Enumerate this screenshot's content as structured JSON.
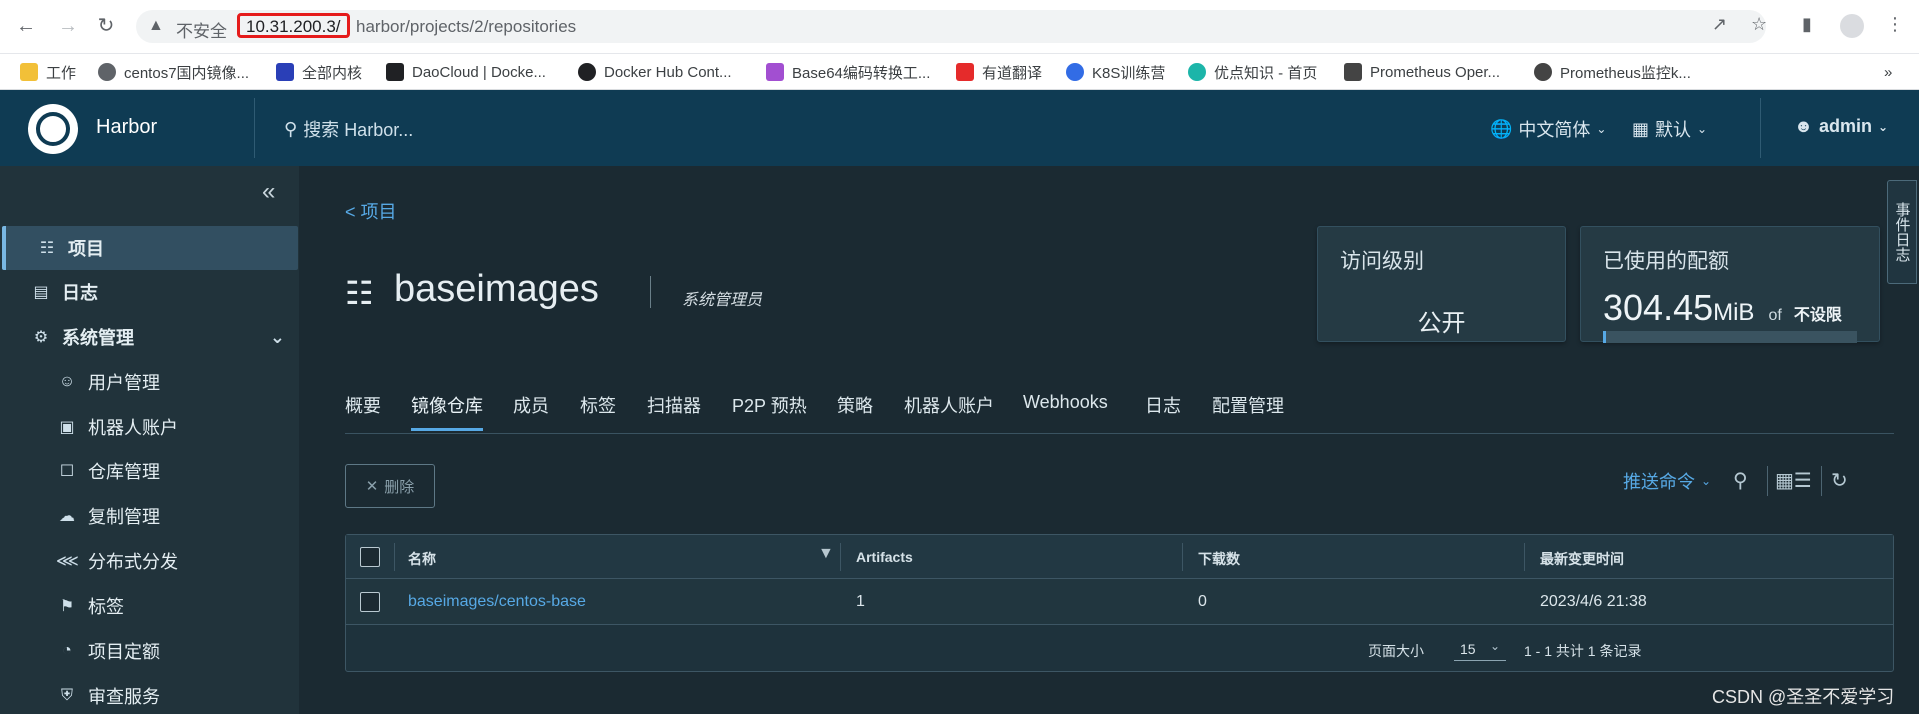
{
  "browser": {
    "insecure_label": "不安全",
    "url_host": "10.31.200.3/",
    "url_path": "harbor/projects/2/repositories",
    "bookmarks": [
      {
        "label": "工作",
        "color": "#f2c038"
      },
      {
        "label": "centos7国内镜像...",
        "color": "#5f6368"
      },
      {
        "label": "全部内核",
        "color": "#2a3fb7"
      },
      {
        "label": "DaoCloud | Docke...",
        "color": "#202124"
      },
      {
        "label": "Docker Hub Cont...",
        "color": "#202124"
      },
      {
        "label": "Base64编码转换工...",
        "color": "#a24fd1"
      },
      {
        "label": "有道翻译",
        "color": "#e52b2b"
      },
      {
        "label": "K8S训练营",
        "color": "#326ce5"
      },
      {
        "label": "优点知识 - 首页",
        "color": "#1cb5a9"
      },
      {
        "label": "Prometheus Oper...",
        "color": "#444444"
      },
      {
        "label": "Prometheus监控k...",
        "color": "#444444"
      }
    ],
    "more_bookmarks": "»"
  },
  "header": {
    "brand": "Harbor",
    "search_placeholder": "搜索 Harbor...",
    "language": "中文简体",
    "theme": "默认",
    "user": "admin"
  },
  "sidebar": {
    "items": [
      {
        "label": "项目",
        "icon": "project-icon"
      },
      {
        "label": "日志",
        "icon": "log-icon"
      },
      {
        "label": "系统管理",
        "icon": "admin-icon"
      },
      {
        "label": "用户管理",
        "icon": "users-icon"
      },
      {
        "label": "机器人账户",
        "icon": "robot-icon"
      },
      {
        "label": "仓库管理",
        "icon": "registry-icon"
      },
      {
        "label": "复制管理",
        "icon": "replication-icon"
      },
      {
        "label": "分布式分发",
        "icon": "share-icon"
      },
      {
        "label": "标签",
        "icon": "tag-icon"
      },
      {
        "label": "项目定额",
        "icon": "quota-icon"
      },
      {
        "label": "审查服务",
        "icon": "shield-icon"
      }
    ]
  },
  "main": {
    "breadcrumb": "< 项目",
    "project_name": "baseimages",
    "role": "系统管理员",
    "access_card": {
      "title": "访问级别",
      "value": "公开"
    },
    "quota_card": {
      "title": "已使用的配额",
      "used": "304.45",
      "unit": "MiB",
      "of": "of",
      "limit": "不设限",
      "fill": 0.01
    },
    "tabs": [
      "概要",
      "镜像仓库",
      "成员",
      "标签",
      "扫描器",
      "P2P 预热",
      "策略",
      "机器人账户",
      "Webhooks",
      "日志",
      "配置管理"
    ],
    "active_tab": "镜像仓库",
    "delete_label": "删除",
    "push_command": "推送命令",
    "table": {
      "headers": [
        "名称",
        "Artifacts",
        "下载数",
        "最新变更时间"
      ],
      "rows": [
        {
          "name": "baseimages/centos-base",
          "artifacts": "1",
          "downloads": "0",
          "updated": "2023/4/6 21:38"
        }
      ],
      "page_size_label": "页面大小",
      "page_size": "15",
      "total": "1 - 1 共计 1 条记录"
    }
  },
  "event_tab": "事件日志",
  "watermark": "CSDN @圣圣不爱学习"
}
